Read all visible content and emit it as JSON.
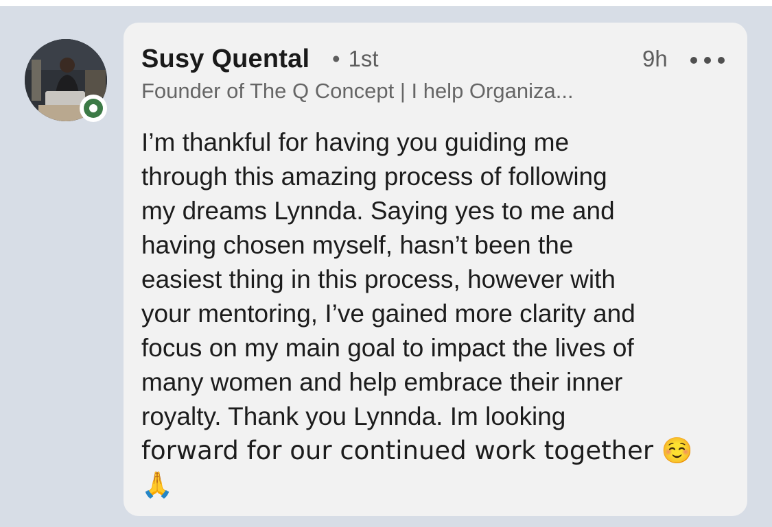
{
  "comment": {
    "author_name": "Susy Quental",
    "connection_degree": "1st",
    "separator": "•",
    "timestamp": "9h",
    "headline": "Founder of The Q Concept | I help Organiza...",
    "message_lines": [
      "I’m thankful for having you guiding me",
      "through this amazing process of following",
      "my dreams Lynnda. Saying yes to me and",
      "having chosen myself, hasn’t been the",
      "easiest thing in this process, however with",
      "your mentoring, I’ve gained more clarity and",
      "focus on my main goal to impact the lives of",
      "many women and help embrace their inner",
      "royalty. Thank you Lynnda. Im looking",
      "forward for our continued work together ☺️",
      "🙏"
    ],
    "more_icon": "more-horizontal-icon",
    "presence_status": "online",
    "colors": {
      "background": "#d7dde6",
      "bubble": "#f2f2f2",
      "presence": "#3c7a46"
    }
  }
}
